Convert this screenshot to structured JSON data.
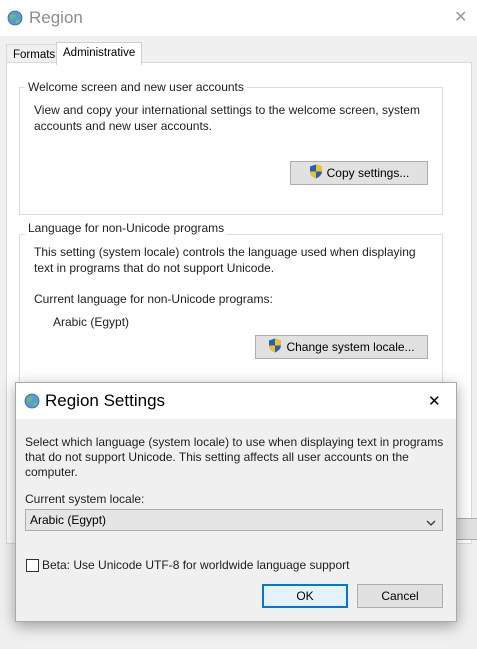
{
  "window": {
    "title": "Region",
    "close_glyph": "✕"
  },
  "tabs": [
    {
      "label": "Formats",
      "active": false
    },
    {
      "label": "Administrative",
      "active": true
    }
  ],
  "welcome": {
    "group_label": "Welcome screen and new user accounts",
    "description_line1": "View and copy your international settings to the welcome screen, system",
    "description_line2": "accounts and new user accounts.",
    "copy_button": "Copy settings..."
  },
  "non_unicode": {
    "group_label": "Language for non-Unicode programs",
    "description_line1": "This setting (system locale) controls the language used when displaying",
    "description_line2": "text in programs that do not support Unicode.",
    "current_label": "Current language for non-Unicode programs:",
    "current_value": "Arabic (Egypt)",
    "change_button": "Change system locale..."
  },
  "dialog": {
    "title": "Region Settings",
    "close_glyph": "✕",
    "instructions_line1": "Select which language (system locale) to use when displaying text in programs",
    "instructions_line2": "that do not support Unicode. This setting affects all user accounts on the",
    "instructions_line3": "computer.",
    "locale_label": "Current system locale:",
    "locale_value": "Arabic (Egypt)",
    "beta_label": "Beta: Use Unicode UTF-8 for worldwide language support",
    "beta_checked": false,
    "ok_button": "OK",
    "cancel_button": "Cancel"
  },
  "colors": {
    "accent": "#0078d7",
    "shield_blue": "#1f5fbf",
    "shield_yellow": "#f2c21b"
  },
  "icons": {
    "window_icon": "globe-icon",
    "button_icon": "uac-shield-icon",
    "dropdown_icon": "chevron-down-icon"
  }
}
